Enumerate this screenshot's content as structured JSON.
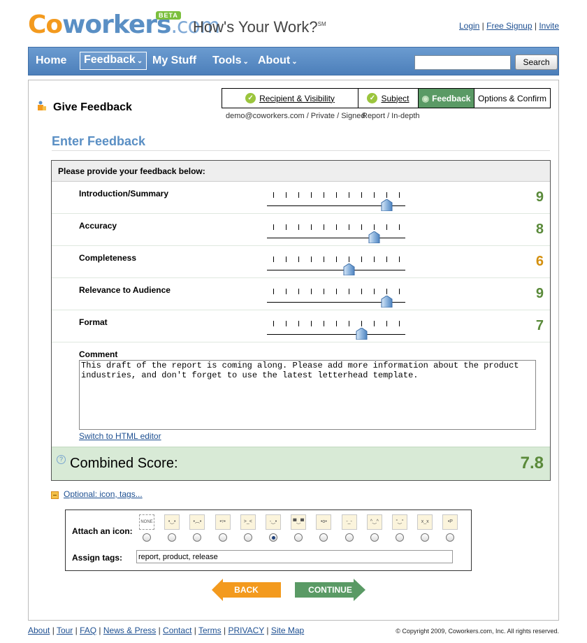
{
  "header": {
    "logo_c": "C",
    "logo_o": "o",
    "logo_workers": "workers",
    "logo_com": ".com",
    "beta": "BETA",
    "tagline": "How's Your Work?",
    "tagline_sm": "SM",
    "links": [
      "Login",
      "Free Signup",
      "Invite"
    ]
  },
  "nav": {
    "items": [
      {
        "label": "Home",
        "dropdown": false
      },
      {
        "label": "Feedback",
        "dropdown": true,
        "active": true
      },
      {
        "label": "My Stuff",
        "dropdown": false
      },
      {
        "label": "Tools",
        "dropdown": true
      },
      {
        "label": "About",
        "dropdown": true
      }
    ],
    "search_value": "",
    "search_button": "Search"
  },
  "page": {
    "title": "Give Feedback",
    "steps": [
      {
        "label": "Recipient & Visibility",
        "done": true
      },
      {
        "label": "Subject",
        "done": true
      },
      {
        "label": "Feedback",
        "active": true
      },
      {
        "label": "Options & Confirm"
      }
    ],
    "step_sub_1": "demo@coworkers.com / Private / Signed",
    "step_sub_2": "Report / In-depth",
    "section_heading": "Enter Feedback",
    "box_header": "Please provide your feedback below:",
    "criteria": [
      {
        "label": "Introduction/Summary",
        "value": "9",
        "level": 9,
        "color": "#5a8a3a"
      },
      {
        "label": "Accuracy",
        "value": "8",
        "level": 8,
        "color": "#5a8a3a"
      },
      {
        "label": "Completeness",
        "value": "6",
        "level": 6,
        "color": "#d4900f"
      },
      {
        "label": "Relevance to Audience",
        "value": "9",
        "level": 9,
        "color": "#5a8a3a"
      },
      {
        "label": "Format",
        "value": "7",
        "level": 7,
        "color": "#5a8a3a"
      }
    ],
    "comment_label": "Comment",
    "comment_text": "This draft of the report is coming along. Please add more information about the product industries, and don't forget to use the latest letterhead template.",
    "html_editor_link": "Switch to HTML editor",
    "combined_help": "?",
    "combined_label": "Combined Score:",
    "combined_value": "7.8",
    "optional_link": "Optional: icon, tags...",
    "attach_label": "Attach an icon:",
    "icon_none_label": "NONE",
    "icons": [
      "none",
      "smile",
      "frown",
      "grin",
      "angry",
      "wink",
      "cool",
      "surprised",
      "tired",
      "blush",
      "angel",
      "dead",
      "tongue"
    ],
    "selected_icon": 5,
    "assign_label": "Assign tags:",
    "tags_value": "report, product, release",
    "back_button": "BACK",
    "continue_button": "CONTINUE"
  },
  "footer": {
    "links": [
      "About",
      "Tour",
      "FAQ",
      "News & Press",
      "Contact",
      "Terms",
      "PRIVACY",
      "Site Map"
    ],
    "copyright": "© Copyright 2009, Coworkers.com, Inc. All rights reserved."
  },
  "colors": {
    "nav_blue": "#4c7fba",
    "logo_orange": "#f39a1e",
    "heading_blue": "#5a8fc4",
    "active_step_green": "#5a9a65",
    "score_green": "#5a8a3a",
    "score_orange": "#d4900f",
    "combined_bg": "#d8ead6",
    "back_orange": "#f39a1e",
    "continue_green": "#5a9a65"
  }
}
